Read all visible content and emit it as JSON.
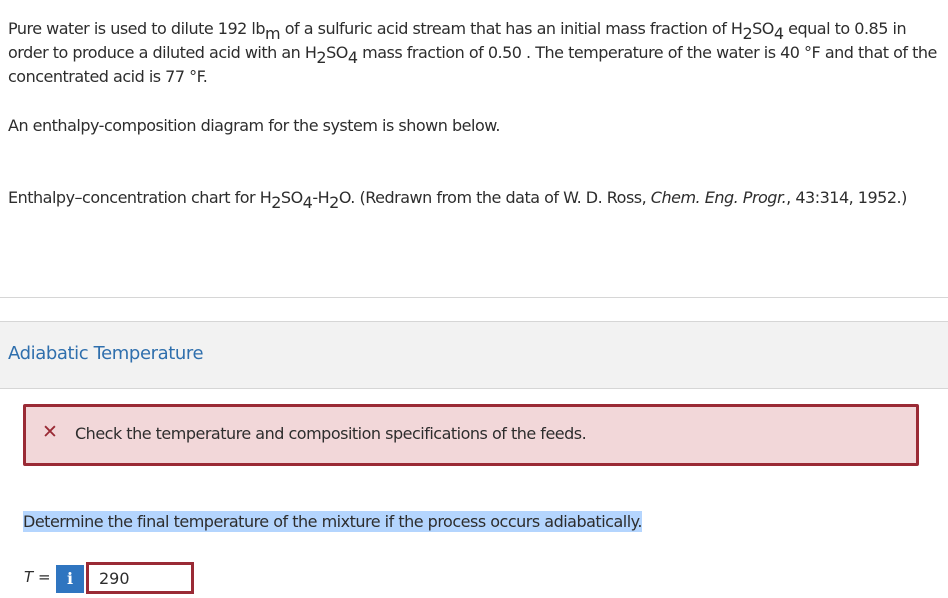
{
  "problem": {
    "intro_1": "Pure water is used to dilute 192 lb",
    "intro_sub_m": "m",
    "intro_2": " of a sulfuric acid stream that has an initial mass fraction of H",
    "intro_sub_2a": "2",
    "intro_3": "SO",
    "intro_sub_4a": "4",
    "intro_4": " equal to 0.85 in order to produce a diluted acid with an H",
    "intro_sub_2b": "2",
    "intro_5": "SO",
    "intro_sub_4b": "4",
    "intro_6": " mass fraction of 0.50 . The temperature of the water is 40 °F and that of the concentrated acid is 77 °F.",
    "diagram_intro": "An enthalpy-composition diagram for the system is shown below.",
    "caption_1": "Enthalpy–concentration chart for H",
    "caption_sub_2a": "2",
    "caption_2": "SO",
    "caption_sub_4": "4",
    "caption_3": "-H",
    "caption_sub_2b": "2",
    "caption_4": "O. (Redrawn from the data of W. D. Ross, ",
    "caption_journal": "Chem. Eng. Progr.",
    "caption_5": ", 43:314, 1952.)"
  },
  "section": {
    "title": "Adiabatic Temperature"
  },
  "feedback": {
    "icon": "x-icon",
    "message": "Check the temperature and composition specifications of the feeds."
  },
  "question": {
    "text": "Determine the final temperature of the mixture if the process occurs adiabatically.",
    "label_var": "T",
    "label_eq": " =",
    "info_glyph": "i",
    "answer_value": "290"
  },
  "colors": {
    "link_blue": "#2f6fad",
    "error_red": "#9a2a35",
    "error_bg": "#f2d7d9",
    "info_blue": "#2f75c0",
    "highlight": "#b4d5fe"
  }
}
